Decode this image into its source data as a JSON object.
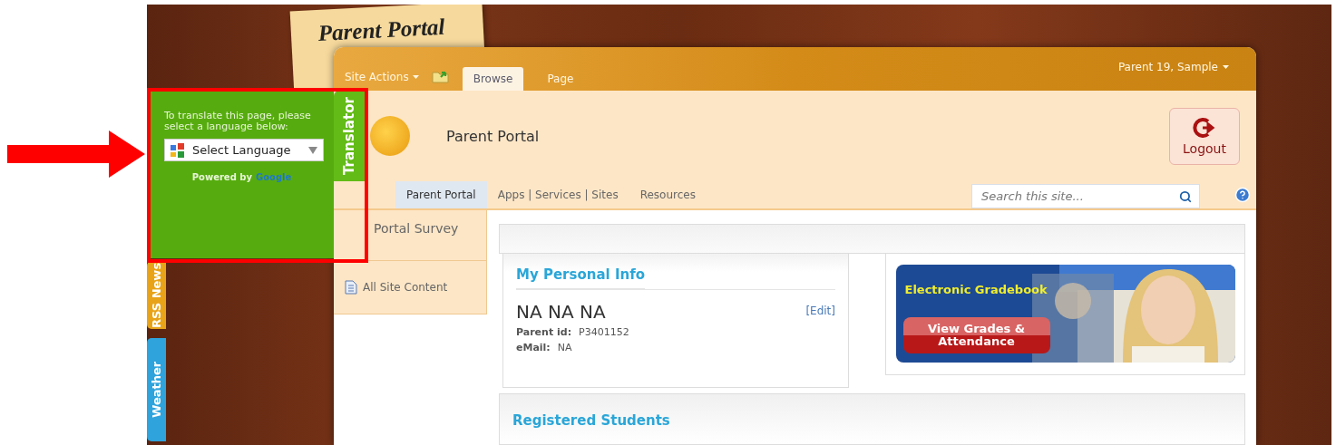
{
  "note_title": "Parent Portal",
  "ribbon": {
    "site_actions": "Site Actions",
    "tabs": [
      {
        "label": "Browse",
        "selected": true
      },
      {
        "label": "Page",
        "selected": false
      }
    ],
    "user": "Parent 19, Sample"
  },
  "header": {
    "site_title": "Parent Portal",
    "logout": "Logout"
  },
  "nav": {
    "tabs": [
      {
        "label": "Parent Portal",
        "selected": true
      },
      {
        "label": "Apps | Services | Sites",
        "selected": false
      },
      {
        "label": "Resources",
        "selected": false
      }
    ],
    "search": {
      "placeholder": "Search this site..."
    }
  },
  "quick_launch": [
    {
      "label": "Portal Survey",
      "kind": "heading"
    },
    {
      "label": "All Site Content",
      "kind": "link"
    }
  ],
  "personal_info": {
    "title": "My Personal Info",
    "name": "NA NA NA",
    "edit": "[Edit]",
    "fields": [
      {
        "label": "Parent id:",
        "value": "P3401152"
      },
      {
        "label": "eMail:",
        "value": "NA"
      }
    ]
  },
  "banner": {
    "title": "Electronic Gradebook",
    "button": "View Grades & Attendance"
  },
  "students": {
    "title": "Registered Students"
  },
  "translator": {
    "tab": "Translator",
    "prompt": "To translate this page, please select a language below:",
    "select": "Select Language",
    "powered_by": "Powered by",
    "brand": "Google"
  },
  "side_tabs": [
    {
      "label": "RSS News",
      "color": "#e8a318"
    },
    {
      "label": "Weather",
      "color": "#2ea3dc"
    }
  ]
}
